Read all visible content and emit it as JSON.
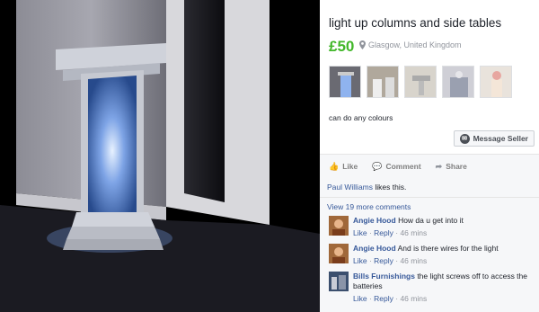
{
  "listing": {
    "title": "light up columns and side tables",
    "price": "£50",
    "location": "Glasgow, United Kingdom",
    "description": "can do any colours",
    "message_button": "Message Seller"
  },
  "thumbnails": [
    {
      "name": "thumbnail-1"
    },
    {
      "name": "thumbnail-2"
    },
    {
      "name": "thumbnail-3"
    },
    {
      "name": "thumbnail-4"
    },
    {
      "name": "thumbnail-5"
    }
  ],
  "actions": {
    "like": "Like",
    "comment": "Comment",
    "share": "Share"
  },
  "likes": {
    "name": "Paul Williams",
    "text": " likes this."
  },
  "view_more": "View 19 more comments",
  "comments": [
    {
      "author": "Angie Hood",
      "text": " How da u get into it",
      "like": "Like",
      "reply": "Reply",
      "time": "46 mins"
    },
    {
      "author": "Angie Hood",
      "text": " And is there wires for the light",
      "like": "Like",
      "reply": "Reply",
      "time": "46 mins"
    },
    {
      "author": "Bills Furnishings",
      "text": " the light screws off to access the batteries",
      "like": "Like",
      "reply": "Reply",
      "time": "46 mins"
    }
  ],
  "colors": {
    "price": "#42b72a",
    "link": "#365899",
    "muted": "#90949c"
  }
}
